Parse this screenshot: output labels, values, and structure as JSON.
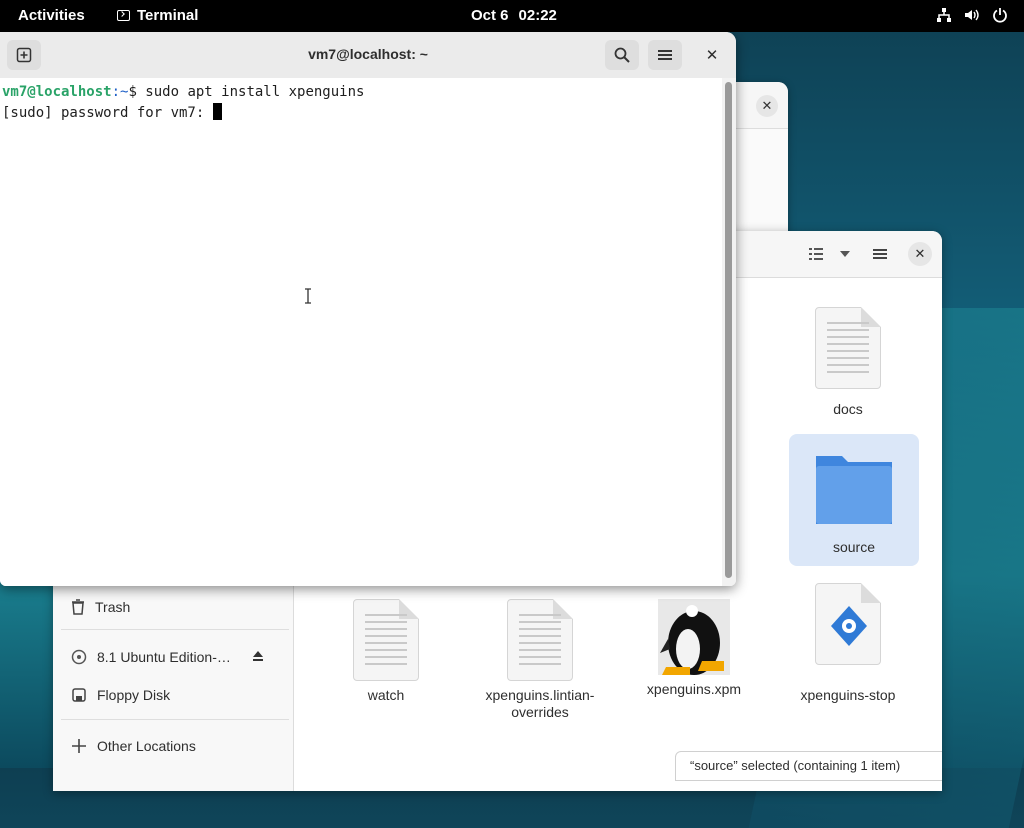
{
  "topbar": {
    "activities": "Activities",
    "app_name": "Terminal",
    "date": "Oct 6",
    "time": "02:22"
  },
  "terminal": {
    "title": "vm7@localhost: ~",
    "prompt_user": "vm7@localhost",
    "prompt_path": ":~",
    "prompt_symbol": "$ ",
    "command": "sudo apt install xpenguins",
    "password_prompt": "[sudo] password for vm7: "
  },
  "file_manager": {
    "sidebar": {
      "trash": "Trash",
      "ubuntu_disc": "8.1 Ubuntu Edition-…",
      "floppy": "Floppy Disk",
      "other_locations": "Other Locations"
    },
    "files": [
      {
        "name": "docs",
        "type": "document"
      },
      {
        "name": "source",
        "type": "folder",
        "selected": true
      },
      {
        "name": "watch",
        "type": "document"
      },
      {
        "name": "xpenguins.lintian-overrides",
        "type": "document"
      },
      {
        "name": "xpenguins.xpm",
        "type": "image"
      },
      {
        "name": "xpenguins-stop",
        "type": "script"
      }
    ],
    "status": "“source” selected  (containing 1 item)"
  },
  "colors": {
    "prompt_user": "#2aa368",
    "prompt_path": "#1d5fc7",
    "selection": "#dbe7f8",
    "folder": "#4a8fe0"
  }
}
